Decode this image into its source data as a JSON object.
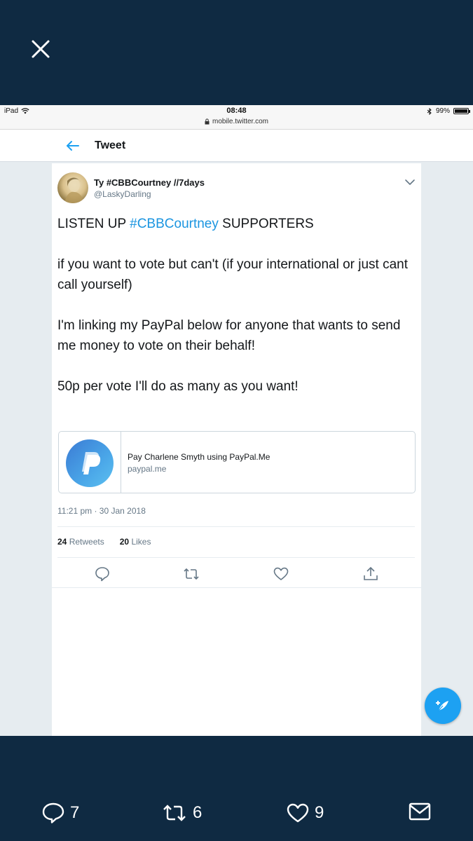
{
  "viewer": {
    "close_icon": "close-icon",
    "counts": {
      "replies": "7",
      "retweets": "6",
      "likes": "9"
    }
  },
  "statusbar": {
    "device": "iPad",
    "time": "08:48",
    "url": "mobile.twitter.com",
    "battery": "99%",
    "battery_level": 0.99
  },
  "header": {
    "title": "Tweet"
  },
  "tweet": {
    "user_name": "Ty #CBBCourtney //7days",
    "handle": "@LaskyDarling",
    "line1_pre": "LISTEN UP ",
    "line1_hashtag": "#CBBCourtney",
    "line1_post": " SUPPORTERS",
    "para2": "if you want to vote but can't  (if your international or just cant call yourself)",
    "para3": "I'm linking my PayPal below for anyone that wants to send me money to vote on their behalf!",
    "para4": "50p per vote I'll do as many as you want!",
    "link_card": {
      "title": "Pay Charlene Smyth using PayPal.Me",
      "domain": "paypal.me"
    },
    "timestamp": "11:21 pm · 30 Jan 2018",
    "retweets_count": "24",
    "retweets_label": "Retweets",
    "likes_count": "20",
    "likes_label": "Likes"
  },
  "colors": {
    "accent": "#1da1f2",
    "link": "#1b95e0",
    "viewer_bg": "#0f2a42"
  }
}
